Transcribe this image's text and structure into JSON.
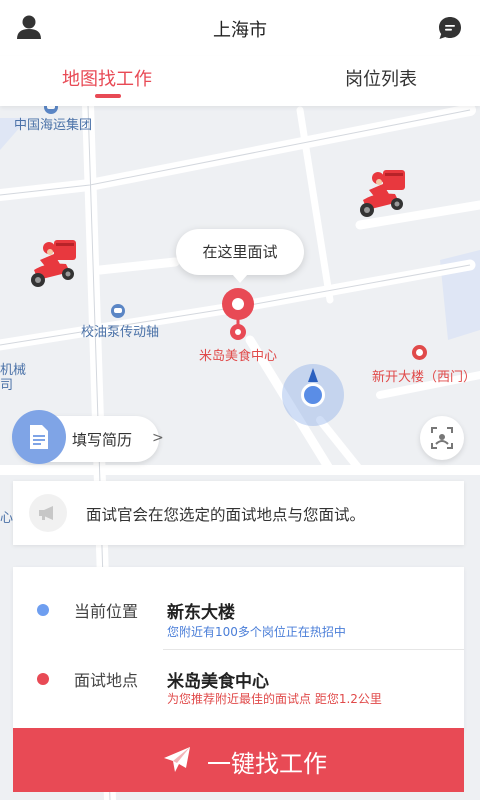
{
  "header": {
    "city": "上海市",
    "user_icon": "user-icon",
    "chat_icon": "chat-bubble-icon"
  },
  "tabs": [
    {
      "label": "地图找工作",
      "active": true
    },
    {
      "label": "岗位列表",
      "active": false
    }
  ],
  "map": {
    "labels": {
      "group": "中国海运集团",
      "pump": "校油泵传动轴",
      "mech_1": "机械",
      "mech_2": "司",
      "edge_char": "心",
      "mida": "米岛美食中心",
      "xinkai": "新开大楼（西门）"
    },
    "bubble_text": "在这里面试",
    "accent_color": "#e84a55",
    "location_color": "#5a8de6"
  },
  "resume_button": {
    "label": "填写简历",
    "chevron": ">"
  },
  "notice": {
    "text": "面试官会在您选定的面试地点与您面试。",
    "icon": "megaphone-icon"
  },
  "panel": {
    "current": {
      "label": "当前位置",
      "value": "新东大楼",
      "sub": "您附近有100多个岗位正在热招中"
    },
    "interview": {
      "label": "面试地点",
      "value": "米岛美食中心",
      "sub": "为您推荐附近最佳的面试点  距您1.2公里"
    }
  },
  "find_button": {
    "label": "一键找工作",
    "icon": "paper-plane-icon"
  }
}
